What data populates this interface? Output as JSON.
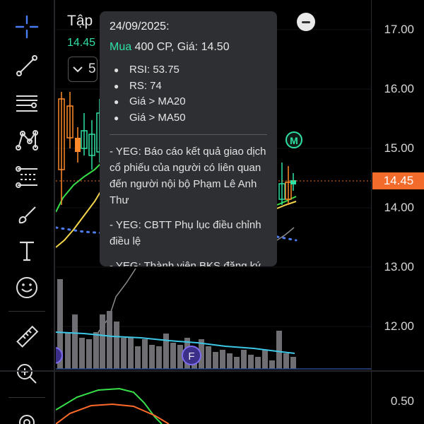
{
  "symbol": {
    "name": "Tập",
    "price": "14.45",
    "interval": "5"
  },
  "tooltip": {
    "date": "24/09/2025:",
    "trade_side": "Mua",
    "trade_detail": "400 CP, Giá: 14.50",
    "signals": [
      "RSI: 53.75",
      "RS: 74",
      "Giá > MA20",
      "Giá > MA50"
    ],
    "news": [
      "- YEG: Báo cáo kết quả giao dịch cổ phiếu của người có liên quan đến người nội bộ Phạm Lê Anh Thư",
      "- YEG: CBTT Phụ lục điều chỉnh điều lệ",
      "- YEG: Thành viên BKS đăng ký"
    ]
  },
  "price_axis": {
    "ticks": [
      "17.00",
      "16.00",
      "15.00",
      "14.00",
      "13.00",
      "12.00"
    ],
    "current_price": "14.45",
    "current_price_color": "#f26b2a"
  },
  "lower_axis": {
    "ticks": [
      "0.50"
    ]
  },
  "markers": {
    "m": "M",
    "f": "F"
  },
  "colors": {
    "up": "#ff8a2a",
    "down": "#2fe0a4",
    "ma_yellow": "#f5d64a",
    "ma_green": "#37e04a",
    "ma_blue": "#4f7cf0",
    "volume_ma": "#3cc7e6"
  },
  "toolbar": {
    "tools": [
      "crosshair-icon",
      "trend-line-icon",
      "horizontal-lines-icon",
      "pattern-icon",
      "fib-icon",
      "brush-icon",
      "text-icon",
      "emoji-icon",
      "ruler-icon",
      "zoom-in-icon",
      "magnet-icon"
    ]
  }
}
